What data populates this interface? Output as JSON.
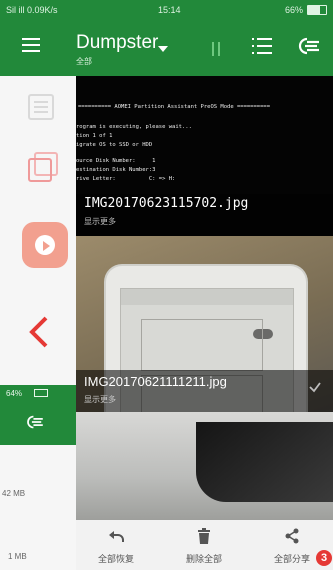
{
  "status_bar": {
    "left": "Sil ill 0.09K/s",
    "time": "15:14",
    "battery": "66%"
  },
  "app_bar": {
    "title": "Dumpster",
    "subtitle": "全部"
  },
  "left_panel": {
    "mini_status": "64%",
    "size_1": "42 MB",
    "size_2": "1 MB"
  },
  "terminal": {
    "lines": [
      "========== AOMEI Partition Assistant PreOS Mode ==========",
      "rogram is executing, please wait...",
      "tion 1 of 1",
      "igrate OS to SSD or HDD",
      "ource Disk Number:     1",
      "estination Disk Number:3",
      "rive Letter:          C: => H:"
    ]
  },
  "photos": [
    {
      "name": "IMG20170623115702.jpg",
      "more": "显示更多"
    },
    {
      "name": "IMG20170621111211.jpg",
      "more": "显示更多"
    }
  ],
  "actions": {
    "restore_label": "全部恢复",
    "delete_label": "删除全部",
    "share_label": "全部分享"
  },
  "badge": "3",
  "icons": {
    "menu": "menu-icon",
    "dropdown": "caret-down-icon",
    "list": "list-view-icon",
    "filter": "filter-icon",
    "back": "chevron-left-icon",
    "restore": "undo-icon",
    "delete": "trash-icon",
    "share": "share-icon",
    "check": "check-icon"
  },
  "colors": {
    "app_green": "#22893a",
    "accent_red": "#e53935"
  }
}
